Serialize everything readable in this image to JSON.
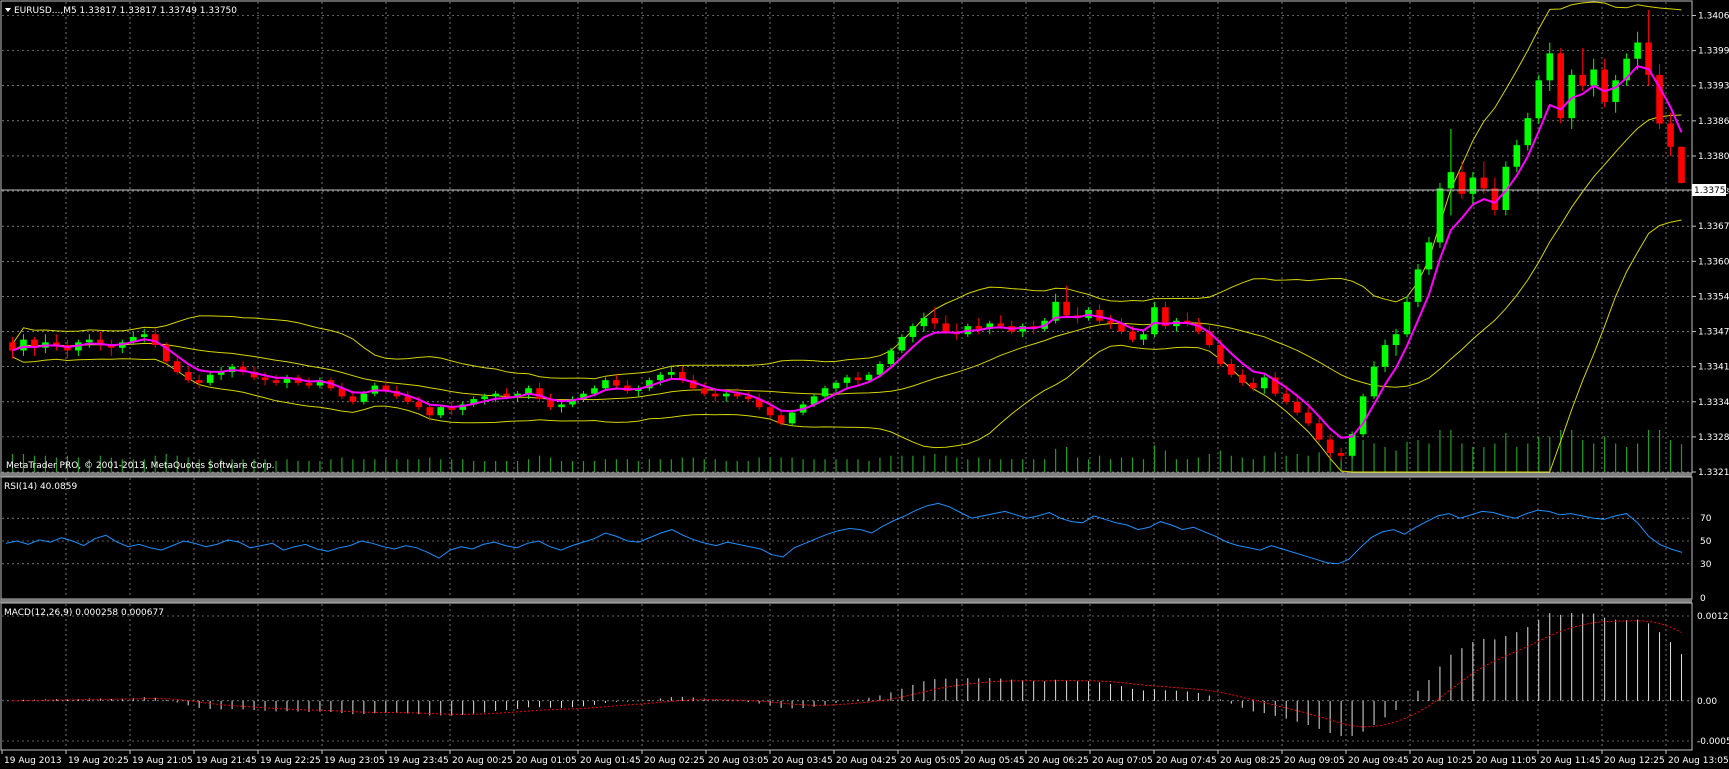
{
  "colors": {
    "background": "#000000",
    "grid": "#c0c0c0",
    "axis_text": "#ffffff",
    "bull_candle": "#00ff00",
    "bear_candle": "#ff0000",
    "ma": "#ff00ff",
    "bollinger": "#d4d400",
    "volume": "#1f9e1f",
    "rsi_line": "#1e90ff",
    "macd_hist": "#e0e0e0",
    "macd_signal": "#ff0000",
    "price_line": "#c0c0c0"
  },
  "main": {
    "header_label": "EURUSD...,M5  1.33817 1.33817 1.33749 1.33750",
    "price_levels": [
      "1.34060",
      "1.33995",
      "1.33930",
      "1.33865",
      "1.33800",
      "1.33735",
      "1.33670",
      "1.33605",
      "1.33540",
      "1.33475",
      "1.33410",
      "1.33345",
      "1.33280",
      "1.33215"
    ],
    "current_price": "1.33750",
    "watermark": "MetaTrader PRO, © 2001-2013, MetaQuotes Software Corp."
  },
  "rsi_panel": {
    "label": "RSI(14) 40.0859",
    "levels": [
      "70",
      "50",
      "30",
      "0"
    ]
  },
  "macd_panel": {
    "label": "MACD(12,26,9) 0.000258 0.000677",
    "levels": [
      "0.001255",
      "0.00",
      "-0.000594"
    ]
  },
  "time_labels": [
    "19 Aug 2013",
    "19 Aug 20:25",
    "19 Aug 21:05",
    "19 Aug 21:45",
    "19 Aug 22:25",
    "19 Aug 23:05",
    "19 Aug 23:45",
    "20 Aug 00:25",
    "20 Aug 01:05",
    "20 Aug 01:45",
    "20 Aug 02:25",
    "20 Aug 03:05",
    "20 Aug 03:45",
    "20 Aug 04:25",
    "20 Aug 05:05",
    "20 Aug 05:45",
    "20 Aug 06:25",
    "20 Aug 07:05",
    "20 Aug 07:45",
    "20 Aug 08:25",
    "20 Aug 09:05",
    "20 Aug 09:45",
    "20 Aug 10:25",
    "20 Aug 11:05",
    "20 Aug 11:45",
    "20 Aug 12:25",
    "20 Aug 13:05"
  ],
  "chart_data": {
    "type": "candlestick",
    "symbol": "EURUSD...",
    "timeframe": "M5",
    "time_range": [
      "19 Aug 2013",
      "20 Aug 13:05"
    ],
    "ylim": [
      1.33215,
      1.34085
    ],
    "ohlc": [
      [
        1.33455,
        1.33465,
        1.33425,
        1.3344
      ],
      [
        1.3344,
        1.3347,
        1.3343,
        1.3346
      ],
      [
        1.3346,
        1.33465,
        1.3343,
        1.33445
      ],
      [
        1.33445,
        1.3347,
        1.33435,
        1.33455
      ],
      [
        1.33455,
        1.3347,
        1.3344,
        1.3345
      ],
      [
        1.3345,
        1.3346,
        1.33425,
        1.3344
      ],
      [
        1.3344,
        1.3346,
        1.3343,
        1.33455
      ],
      [
        1.33455,
        1.3347,
        1.33445,
        1.3346
      ],
      [
        1.3346,
        1.33475,
        1.3344,
        1.3345
      ],
      [
        1.3345,
        1.3346,
        1.3343,
        1.33445
      ],
      [
        1.33445,
        1.3346,
        1.33435,
        1.33455
      ],
      [
        1.33455,
        1.33475,
        1.3345,
        1.33465
      ],
      [
        1.33465,
        1.3348,
        1.33455,
        1.3347
      ],
      [
        1.3347,
        1.3348,
        1.33445,
        1.3345
      ],
      [
        1.3345,
        1.33455,
        1.33415,
        1.3342
      ],
      [
        1.3342,
        1.3343,
        1.33395,
        1.334
      ],
      [
        1.334,
        1.3341,
        1.3338,
        1.33385
      ],
      [
        1.33385,
        1.33395,
        1.3337,
        1.3338
      ],
      [
        1.3338,
        1.334,
        1.33375,
        1.33395
      ],
      [
        1.33395,
        1.3341,
        1.33385,
        1.334
      ],
      [
        1.334,
        1.33415,
        1.3339,
        1.3341
      ],
      [
        1.3341,
        1.3342,
        1.33395,
        1.334
      ],
      [
        1.334,
        1.3341,
        1.33385,
        1.3339
      ],
      [
        1.3339,
        1.334,
        1.33375,
        1.33385
      ],
      [
        1.33385,
        1.33395,
        1.33375,
        1.3338
      ],
      [
        1.3338,
        1.33395,
        1.3337,
        1.3339
      ],
      [
        1.3339,
        1.33395,
        1.33375,
        1.3338
      ],
      [
        1.3338,
        1.3339,
        1.3337,
        1.33375
      ],
      [
        1.33375,
        1.3339,
        1.3337,
        1.33385
      ],
      [
        1.33385,
        1.3339,
        1.33365,
        1.3337
      ],
      [
        1.3337,
        1.3338,
        1.3335,
        1.33355
      ],
      [
        1.33355,
        1.33365,
        1.3334,
        1.33345
      ],
      [
        1.33345,
        1.33365,
        1.3334,
        1.3336
      ],
      [
        1.3336,
        1.3338,
        1.33355,
        1.33375
      ],
      [
        1.33375,
        1.33385,
        1.3336,
        1.33365
      ],
      [
        1.33365,
        1.33375,
        1.3335,
        1.33355
      ],
      [
        1.33355,
        1.33365,
        1.3334,
        1.33345
      ],
      [
        1.33345,
        1.33355,
        1.3333,
        1.33335
      ],
      [
        1.33335,
        1.3334,
        1.3331,
        1.3332
      ],
      [
        1.3332,
        1.3334,
        1.33315,
        1.33335
      ],
      [
        1.33335,
        1.33345,
        1.3332,
        1.3333
      ],
      [
        1.3333,
        1.33345,
        1.3332,
        1.3334
      ],
      [
        1.3334,
        1.33355,
        1.33335,
        1.3335
      ],
      [
        1.3335,
        1.3336,
        1.3334,
        1.33355
      ],
      [
        1.33355,
        1.33365,
        1.33345,
        1.3336
      ],
      [
        1.3336,
        1.3337,
        1.3335,
        1.33355
      ],
      [
        1.33355,
        1.33365,
        1.33345,
        1.3336
      ],
      [
        1.3336,
        1.33375,
        1.3335,
        1.3337
      ],
      [
        1.3337,
        1.3338,
        1.33345,
        1.3335
      ],
      [
        1.3335,
        1.3336,
        1.3333,
        1.33335
      ],
      [
        1.33335,
        1.33345,
        1.33325,
        1.3334
      ],
      [
        1.3334,
        1.33355,
        1.33335,
        1.3335
      ],
      [
        1.3335,
        1.33365,
        1.33345,
        1.3336
      ],
      [
        1.3336,
        1.33375,
        1.33355,
        1.3337
      ],
      [
        1.3337,
        1.3339,
        1.33365,
        1.33385
      ],
      [
        1.33385,
        1.33395,
        1.3337,
        1.33375
      ],
      [
        1.33375,
        1.33385,
        1.3336,
        1.33365
      ],
      [
        1.33365,
        1.33375,
        1.33355,
        1.3337
      ],
      [
        1.3337,
        1.3339,
        1.33365,
        1.33385
      ],
      [
        1.33385,
        1.334,
        1.33375,
        1.33395
      ],
      [
        1.33395,
        1.3341,
        1.33385,
        1.334
      ],
      [
        1.334,
        1.3341,
        1.3338,
        1.33385
      ],
      [
        1.33385,
        1.33395,
        1.33365,
        1.3337
      ],
      [
        1.3337,
        1.3338,
        1.33355,
        1.3336
      ],
      [
        1.3336,
        1.3337,
        1.33345,
        1.33355
      ],
      [
        1.33355,
        1.33365,
        1.33345,
        1.3336
      ],
      [
        1.3336,
        1.3337,
        1.3335,
        1.33355
      ],
      [
        1.33355,
        1.33365,
        1.33345,
        1.3335
      ],
      [
        1.3335,
        1.3336,
        1.3333,
        1.33335
      ],
      [
        1.33335,
        1.33345,
        1.33315,
        1.3332
      ],
      [
        1.3332,
        1.3333,
        1.333,
        1.33305
      ],
      [
        1.33305,
        1.3333,
        1.333,
        1.33325
      ],
      [
        1.33325,
        1.33345,
        1.3332,
        1.3334
      ],
      [
        1.3334,
        1.3336,
        1.33335,
        1.33355
      ],
      [
        1.33355,
        1.33375,
        1.3335,
        1.3337
      ],
      [
        1.3337,
        1.33385,
        1.3336,
        1.3338
      ],
      [
        1.3338,
        1.33395,
        1.3337,
        1.3339
      ],
      [
        1.3339,
        1.334,
        1.33375,
        1.33385
      ],
      [
        1.33385,
        1.334,
        1.3338,
        1.33395
      ],
      [
        1.33395,
        1.3342,
        1.3339,
        1.33415
      ],
      [
        1.33415,
        1.33445,
        1.3341,
        1.3344
      ],
      [
        1.3344,
        1.3347,
        1.33435,
        1.33465
      ],
      [
        1.33465,
        1.3349,
        1.33455,
        1.33485
      ],
      [
        1.33485,
        1.3351,
        1.33475,
        1.335
      ],
      [
        1.335,
        1.3352,
        1.3348,
        1.3349
      ],
      [
        1.3349,
        1.33505,
        1.3347,
        1.33475
      ],
      [
        1.33475,
        1.3349,
        1.3346,
        1.3347
      ],
      [
        1.3347,
        1.3349,
        1.33465,
        1.33485
      ],
      [
        1.33485,
        1.335,
        1.3347,
        1.3348
      ],
      [
        1.3348,
        1.33495,
        1.3347,
        1.3349
      ],
      [
        1.3349,
        1.33505,
        1.3348,
        1.33485
      ],
      [
        1.33485,
        1.33495,
        1.3347,
        1.33475
      ],
      [
        1.33475,
        1.3349,
        1.33465,
        1.33485
      ],
      [
        1.33485,
        1.33495,
        1.3347,
        1.3348
      ],
      [
        1.3348,
        1.335,
        1.33475,
        1.33495
      ],
      [
        1.33495,
        1.33545,
        1.3349,
        1.3353
      ],
      [
        1.3353,
        1.3356,
        1.335,
        1.33505
      ],
      [
        1.33505,
        1.3352,
        1.3349,
        1.335
      ],
      [
        1.335,
        1.3352,
        1.33495,
        1.33515
      ],
      [
        1.33515,
        1.33525,
        1.3349,
        1.33495
      ],
      [
        1.33495,
        1.33505,
        1.3348,
        1.3349
      ],
      [
        1.3349,
        1.335,
        1.3347,
        1.33475
      ],
      [
        1.33475,
        1.33485,
        1.33455,
        1.3346
      ],
      [
        1.3346,
        1.33475,
        1.3345,
        1.3347
      ],
      [
        1.3347,
        1.3353,
        1.33465,
        1.3352
      ],
      [
        1.3352,
        1.3353,
        1.3348,
        1.33485
      ],
      [
        1.33485,
        1.335,
        1.33475,
        1.33495
      ],
      [
        1.33495,
        1.3351,
        1.33485,
        1.3349
      ],
      [
        1.3349,
        1.335,
        1.3347,
        1.33475
      ],
      [
        1.33475,
        1.33485,
        1.33445,
        1.3345
      ],
      [
        1.3345,
        1.3346,
        1.3341,
        1.33415
      ],
      [
        1.33415,
        1.33425,
        1.3339,
        1.33395
      ],
      [
        1.33395,
        1.33405,
        1.33375,
        1.3338
      ],
      [
        1.3338,
        1.3339,
        1.33365,
        1.3337
      ],
      [
        1.3337,
        1.33395,
        1.3336,
        1.3339
      ],
      [
        1.3339,
        1.334,
        1.33355,
        1.3336
      ],
      [
        1.3336,
        1.33375,
        1.3334,
        1.33345
      ],
      [
        1.33345,
        1.3336,
        1.3332,
        1.33325
      ],
      [
        1.33325,
        1.33335,
        1.333,
        1.33305
      ],
      [
        1.33305,
        1.33315,
        1.3327,
        1.33275
      ],
      [
        1.33275,
        1.33285,
        1.3324,
        1.3325
      ],
      [
        1.3325,
        1.3326,
        1.33235,
        1.33245
      ],
      [
        1.33245,
        1.3329,
        1.3324,
        1.33285
      ],
      [
        1.33285,
        1.3336,
        1.3328,
        1.33355
      ],
      [
        1.33355,
        1.3342,
        1.3335,
        1.3341
      ],
      [
        1.3341,
        1.3346,
        1.334,
        1.3345
      ],
      [
        1.3345,
        1.3348,
        1.3343,
        1.3347
      ],
      [
        1.3347,
        1.3354,
        1.33465,
        1.3353
      ],
      [
        1.3353,
        1.336,
        1.3352,
        1.3359
      ],
      [
        1.3359,
        1.3365,
        1.3358,
        1.3364
      ],
      [
        1.3364,
        1.3375,
        1.3363,
        1.3374
      ],
      [
        1.3374,
        1.3385,
        1.3369,
        1.3377
      ],
      [
        1.3377,
        1.3379,
        1.3372,
        1.3373
      ],
      [
        1.3373,
        1.3377,
        1.3371,
        1.3376
      ],
      [
        1.3376,
        1.3379,
        1.3373,
        1.3374
      ],
      [
        1.3374,
        1.3376,
        1.3369,
        1.337
      ],
      [
        1.337,
        1.3379,
        1.3369,
        1.3378
      ],
      [
        1.3378,
        1.3383,
        1.3377,
        1.3382
      ],
      [
        1.3382,
        1.3388,
        1.3381,
        1.3387
      ],
      [
        1.3387,
        1.3395,
        1.3386,
        1.3394
      ],
      [
        1.3394,
        1.3401,
        1.3392,
        1.3399
      ],
      [
        1.3399,
        1.34,
        1.3386,
        1.3387
      ],
      [
        1.3387,
        1.3396,
        1.3385,
        1.3395
      ],
      [
        1.3395,
        1.34,
        1.3392,
        1.3393
      ],
      [
        1.3393,
        1.3398,
        1.3391,
        1.3396
      ],
      [
        1.3396,
        1.3398,
        1.3389,
        1.339
      ],
      [
        1.339,
        1.3395,
        1.3388,
        1.3394
      ],
      [
        1.3394,
        1.3399,
        1.3393,
        1.3398
      ],
      [
        1.3398,
        1.3403,
        1.3396,
        1.3401
      ],
      [
        1.3401,
        1.3407,
        1.3393,
        1.3395
      ],
      [
        1.3395,
        1.3397,
        1.3385,
        1.3386
      ],
      [
        1.3386,
        1.3388,
        1.338,
        1.33817
      ],
      [
        1.33817,
        1.33817,
        1.33749,
        1.3375
      ]
    ],
    "ma_color": "#ff00ff",
    "bollinger_color": "#d4d400",
    "rsi": {
      "period": 14,
      "last": 40.0859,
      "levels": [
        70,
        50,
        30,
        0
      ],
      "values": [
        48,
        50,
        47,
        51,
        49,
        53,
        50,
        46,
        52,
        55,
        49,
        45,
        47,
        44,
        42,
        46,
        50,
        48,
        45,
        47,
        51,
        49,
        44,
        46,
        48,
        42,
        45,
        47,
        43,
        41,
        44,
        46,
        50,
        48,
        45,
        43,
        46,
        44,
        40,
        35,
        42,
        45,
        43,
        47,
        49,
        46,
        44,
        48,
        50,
        45,
        42,
        46,
        49,
        52,
        57,
        54,
        50,
        49,
        53,
        57,
        60,
        55,
        51,
        48,
        46,
        49,
        47,
        45,
        43,
        38,
        36,
        44,
        48,
        52,
        56,
        59,
        61,
        60,
        57,
        63,
        68,
        72,
        77,
        81,
        83,
        80,
        75,
        70,
        72,
        74,
        76,
        73,
        70,
        72,
        75,
        70,
        67,
        66,
        72,
        69,
        66,
        64,
        60,
        62,
        67,
        64,
        60,
        62,
        58,
        54,
        49,
        46,
        44,
        42,
        46,
        43,
        40,
        37,
        34,
        31,
        30,
        34,
        44,
        53,
        58,
        60,
        56,
        62,
        67,
        72,
        74,
        70,
        73,
        76,
        75,
        72,
        70,
        74,
        77,
        76,
        73,
        74,
        72,
        70,
        69,
        72,
        74,
        66,
        54,
        47,
        43,
        40
      ],
      "color": "#1e90ff"
    },
    "macd": {
      "params": [
        12,
        26,
        9
      ],
      "last_main": 0.000258,
      "last_signal": 0.000677,
      "levels": [
        0.001255,
        0.0,
        -0.000594
      ],
      "hist_color": "#e0e0e0",
      "signal_color": "#ff0000"
    }
  }
}
